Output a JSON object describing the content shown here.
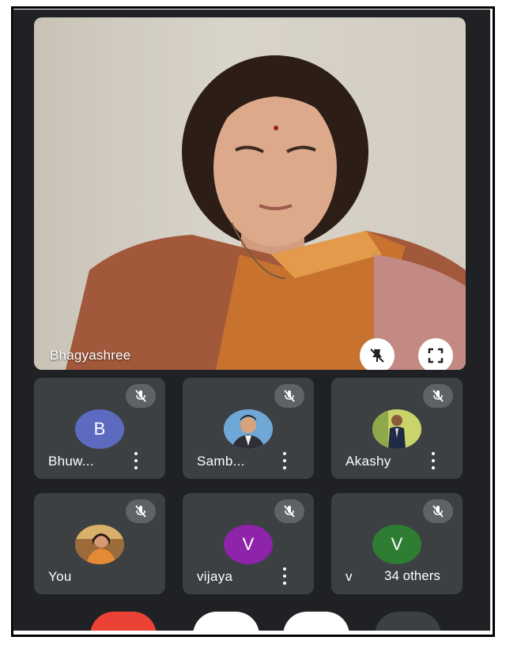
{
  "main": {
    "speaker_name": "Bhagyashree",
    "pin_icon": "pin-off-icon",
    "fullscreen_icon": "fullscreen-icon"
  },
  "participants": [
    {
      "name": "Bhuw...",
      "initial": "B",
      "avatar_color": "#5c6bc0",
      "has_menu": true
    },
    {
      "name": "Samb...",
      "initial": "",
      "avatar_color": "#6fa8d6",
      "has_menu": true
    },
    {
      "name": "Akashy",
      "initial": "",
      "avatar_color": "#b7c95a",
      "has_menu": true
    },
    {
      "name": "You",
      "initial": "",
      "avatar_color": "#c98a52",
      "has_menu": false
    },
    {
      "name": "vijaya",
      "initial": "V",
      "avatar_color": "#8e24aa",
      "has_menu": true
    },
    {
      "name": "v",
      "initial": "V",
      "avatar_color": "#2e7d32",
      "has_menu": false
    }
  ],
  "others_badge": "34 others",
  "controls": {
    "end_call_color": "#ea4335"
  },
  "colors": {
    "background": "#202124",
    "tile": "#3c4043",
    "mute_badge": "#5f6368"
  }
}
